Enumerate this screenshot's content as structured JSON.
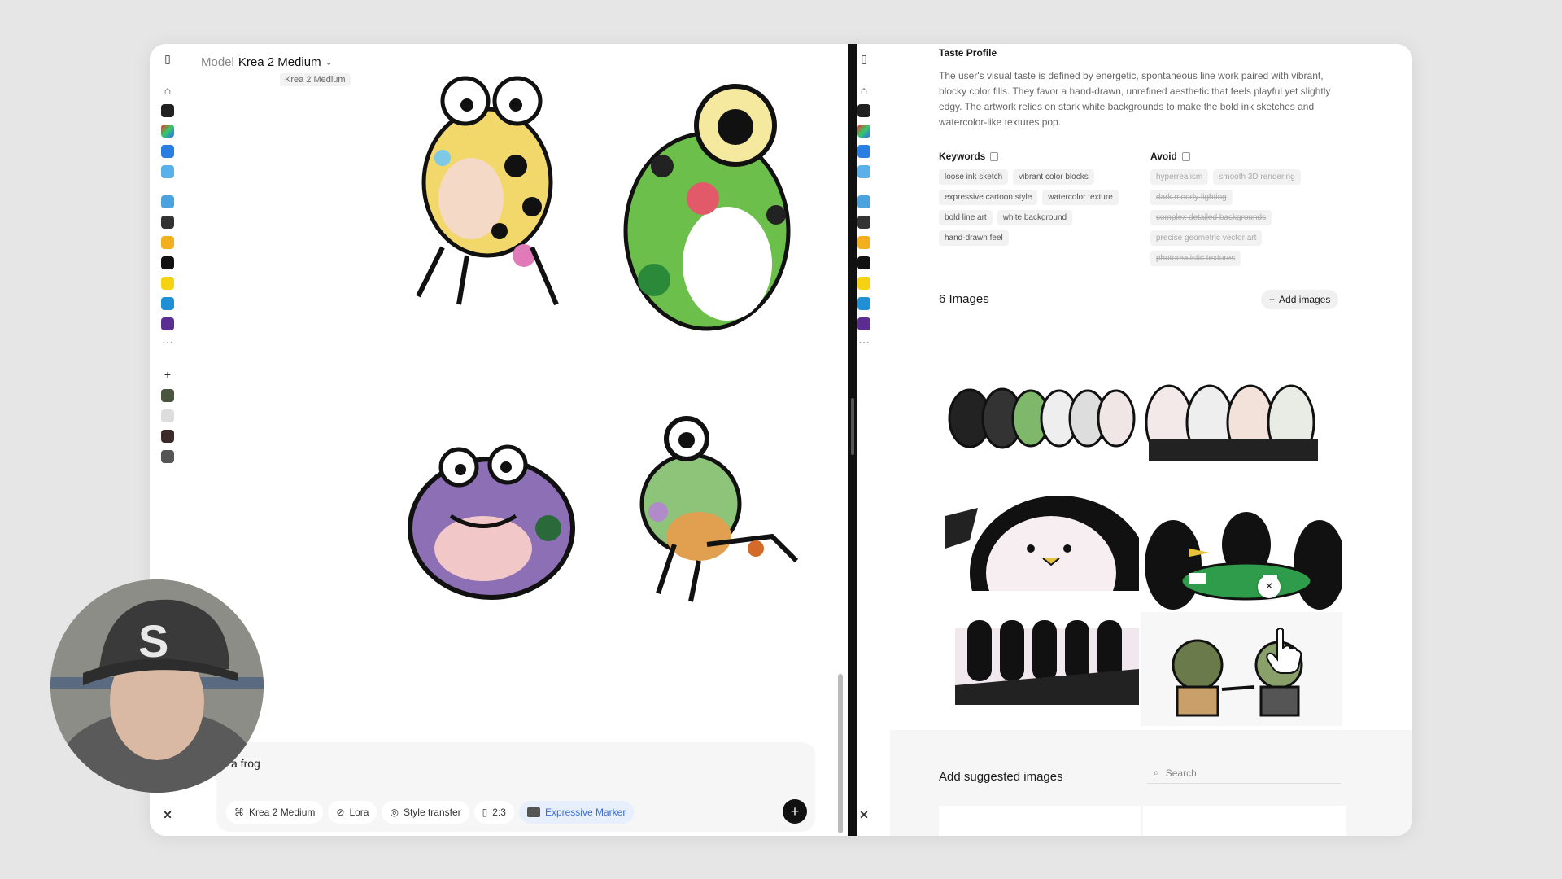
{
  "model": {
    "label": "Model",
    "value": "Krea 2 Medium",
    "sub_label": "Krea 2 Medium"
  },
  "prompt": {
    "text": "a frog",
    "chips": [
      {
        "label": "Krea 2 Medium",
        "icon": "krea-icon"
      },
      {
        "label": "Lora",
        "icon": "link-icon"
      },
      {
        "label": "Style transfer",
        "icon": "palette-icon"
      },
      {
        "label": "2:3",
        "icon": "aspect-icon"
      },
      {
        "label": "Expressive Marker",
        "icon": "style-thumb-icon"
      }
    ],
    "send_icon": "plus-icon"
  },
  "taste_profile": {
    "title": "Taste Profile",
    "description": "The user's visual taste is defined by energetic, spontaneous line work paired with vibrant, blocky color fills. They favor a hand-drawn, unrefined aesthetic that feels playful yet slightly edgy. The artwork relies on stark white backgrounds to make the bold ink sketches and watercolor-like textures pop.",
    "keywords_title": "Keywords",
    "keywords": [
      "loose ink sketch",
      "vibrant color blocks",
      "expressive cartoon style",
      "watercolor texture",
      "bold line art",
      "white background",
      "hand-drawn feel"
    ],
    "avoid_title": "Avoid",
    "avoid": [
      "hyperrealism",
      "smooth 3D rendering",
      "dark moody lighting",
      "complex detailed backgrounds",
      "precise geometric vector art",
      "photorealistic textures"
    ]
  },
  "images": {
    "title": "6 Images",
    "add_label": "Add images",
    "close_icon": "close-icon"
  },
  "suggested": {
    "title": "Add suggested images",
    "search_placeholder": "Search"
  },
  "colors": {
    "accent": "#3b6fd6",
    "divider": "#111111",
    "chip_accent_bg": "#e7eefc"
  }
}
